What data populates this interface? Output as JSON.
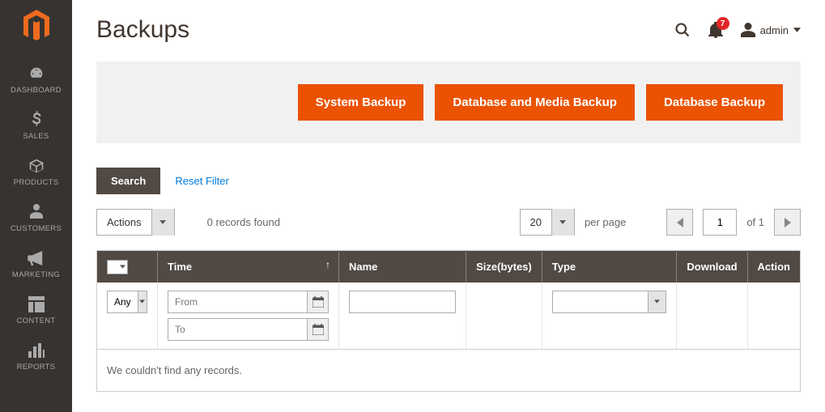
{
  "colors": {
    "accent": "#eb5202",
    "sidebar": "#373330",
    "header_bg": "#514943",
    "link": "#007bdb",
    "badge": "#e22626"
  },
  "sidebar": {
    "items": [
      {
        "label": "DASHBOARD"
      },
      {
        "label": "SALES"
      },
      {
        "label": "PRODUCTS"
      },
      {
        "label": "CUSTOMERS"
      },
      {
        "label": "MARKETING"
      },
      {
        "label": "CONTENT"
      },
      {
        "label": "REPORTS"
      }
    ]
  },
  "header": {
    "title": "Backups",
    "notification_count": "7",
    "username": "admin"
  },
  "toolbar": {
    "system_backup": "System Backup",
    "db_media_backup": "Database and Media Backup",
    "db_backup": "Database Backup"
  },
  "filters": {
    "search_label": "Search",
    "reset_label": "Reset Filter",
    "actions_label": "Actions",
    "records_found": "0 records found",
    "per_page_value": "20",
    "per_page_label": "per page",
    "page_value": "1",
    "page_total": "of 1",
    "any_label": "Any",
    "from_placeholder": "From",
    "to_placeholder": "To"
  },
  "columns": {
    "time": "Time",
    "name": "Name",
    "size": "Size(bytes)",
    "type": "Type",
    "download": "Download",
    "action": "Action"
  },
  "grid": {
    "empty_message": "We couldn't find any records."
  }
}
